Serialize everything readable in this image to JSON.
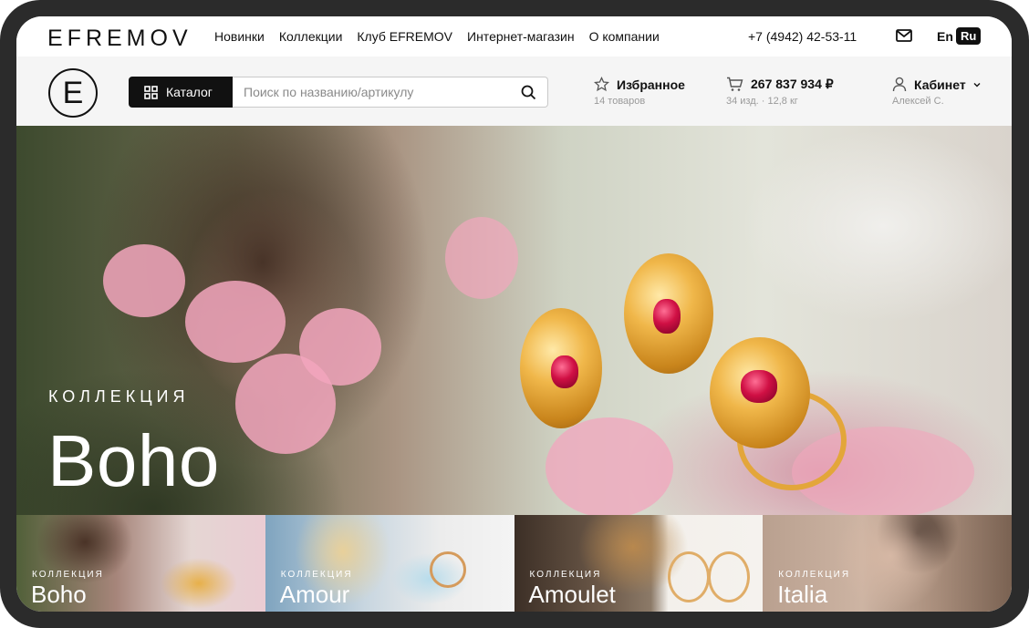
{
  "topbar": {
    "brand": "EFREMOV",
    "nav": [
      "Новинки",
      "Коллекции",
      "Клуб EFREMOV",
      "Интернет-магазин",
      "О компании"
    ],
    "phone": "+7 (4942) 42-53-11",
    "lang_en": "En",
    "lang_ru": "Ru"
  },
  "header": {
    "logo_letter": "E",
    "catalog_label": "Каталог",
    "search_placeholder": "Поиск по названию/артикулу",
    "favorites": {
      "label": "Избранное",
      "sub": "14 товаров"
    },
    "cart": {
      "label": "267 837 934 ₽",
      "sub": "34 изд. · 12,8 кг"
    },
    "cabinet": {
      "label": "Кабинет",
      "sub": "Алексей С."
    }
  },
  "hero": {
    "kicker": "КОЛЛЕКЦИЯ",
    "title": "Boho"
  },
  "cards": [
    {
      "kicker": "КОЛЛЕКЦИЯ",
      "name": "Boho"
    },
    {
      "kicker": "КОЛЛЕКЦИЯ",
      "name": "Amour"
    },
    {
      "kicker": "КОЛЛЕКЦИЯ",
      "name": "Amoulet"
    },
    {
      "kicker": "КОЛЛЕКЦИЯ",
      "name": "Italia"
    }
  ],
  "colors": {
    "accent": "#111111",
    "muted": "#9a9a9a",
    "header_bg": "#f5f5f5"
  }
}
